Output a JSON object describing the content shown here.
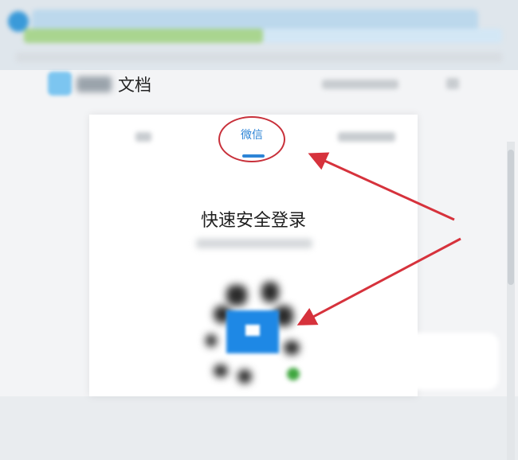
{
  "header": {
    "logo_text": "文档"
  },
  "login": {
    "tab_active_label": "微信",
    "title": "快速安全登录"
  },
  "icons": {
    "browser": "browser-icon",
    "logo": "docs-logo-icon",
    "qr": "qr-code-icon",
    "arrow": "red-arrow-icon"
  },
  "colors": {
    "accent": "#2d84d6",
    "annotation": "#c8303a",
    "qr_center": "#1e88e5"
  }
}
